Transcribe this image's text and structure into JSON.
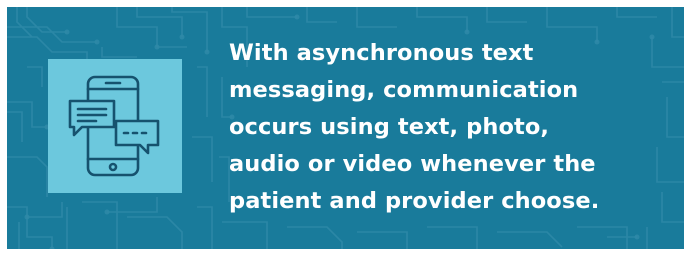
{
  "colors": {
    "panel": "#197b9b",
    "circuit_pattern": "#2f8aa8",
    "icon_tile": "#6cc8dd",
    "icon_stroke": "#16526e",
    "text": "#ffffff"
  },
  "icon": "smartphone-with-chat-bubbles-icon",
  "headline_lines": [
    "With asynchronous text",
    "messaging, communication",
    "occurs using text, photo,",
    "audio or video whenever the",
    "patient and provider choose."
  ]
}
